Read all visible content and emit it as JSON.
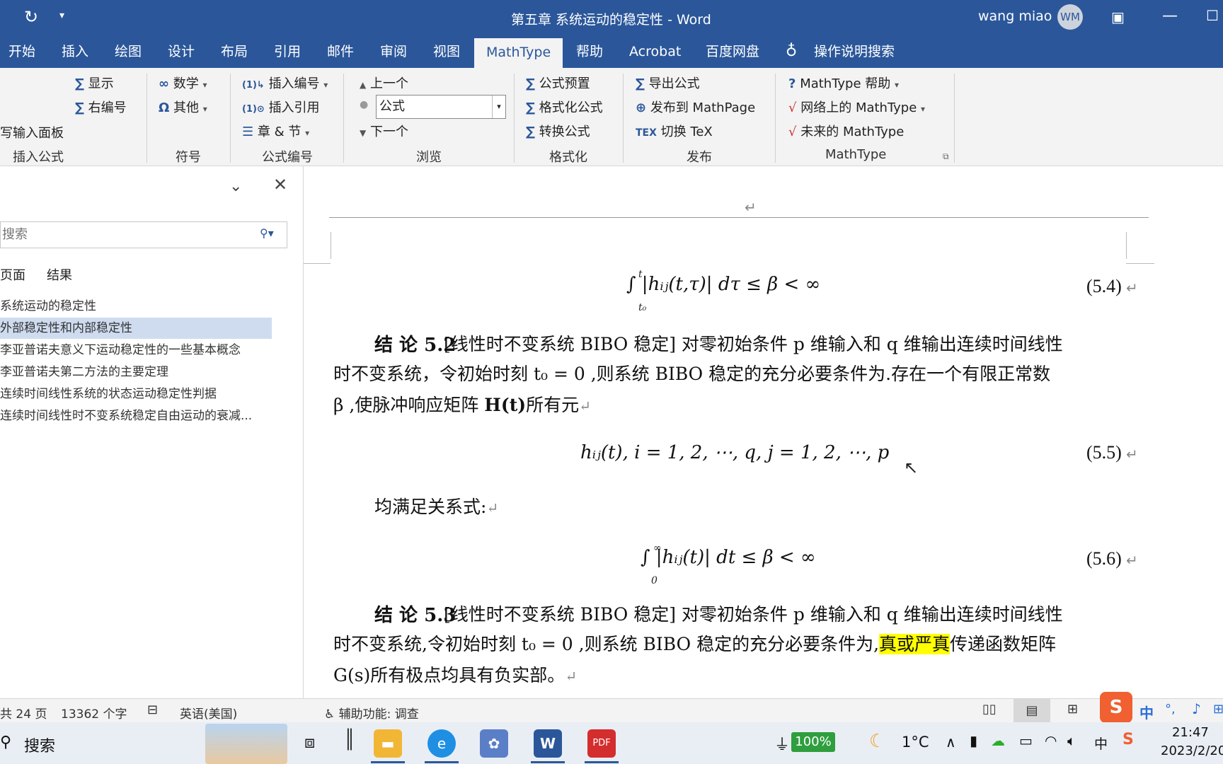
{
  "title_bar": {
    "title": "第五章 系统运动的稳定性  -  Word",
    "user_name": "wang miao",
    "avatar_initials": "WM"
  },
  "ribbon_tabs": [
    "开始",
    "插入",
    "绘图",
    "设计",
    "布局",
    "引用",
    "邮件",
    "审阅",
    "视图",
    "MathType",
    "帮助",
    "Acrobat",
    "百度网盘"
  ],
  "active_tab": "MathType",
  "tell_me": "操作说明搜索",
  "ribbon": {
    "insert_equation": {
      "group": "插入公式",
      "handwrite": "写输入面板",
      "display": "显示",
      "right_number": "右编号"
    },
    "symbols": {
      "group": "符号",
      "math": "数学",
      "other": "其他"
    },
    "equation_numbers": {
      "group": "公式编号",
      "insert_number": "插入编号",
      "insert_reference": "插入引用",
      "chapter_section": "章 & 节"
    },
    "browse": {
      "group": "浏览",
      "previous": "上一个",
      "field_value": "公式",
      "next": "下一个"
    },
    "format": {
      "group": "格式化",
      "presets": "公式预置",
      "format_equations": "格式化公式",
      "convert": "转换公式"
    },
    "publish": {
      "group": "发布",
      "export": "导出公式",
      "mathpage": "发布到 MathPage",
      "toggle_tex": "切换 TeX"
    },
    "mathtype": {
      "group": "MathType",
      "help": "MathType 帮助",
      "online": "网络上的 MathType",
      "future": "未来的 MathType"
    }
  },
  "nav_pane": {
    "search_placeholder": "搜索",
    "tab_pages": "页面",
    "tab_results": "结果",
    "headings": [
      "系统运动的稳定性",
      "外部稳定性和内部稳定性",
      "李亚普诺夫意义下运动稳定性的一些基本概念",
      "李亚普诺夫第二方法的主要定理",
      "连续时间线性系统的状态运动稳定性判据",
      "连续时间线性时不变系统稳定自由运动的衰减..."
    ],
    "selected_index": 1
  },
  "document": {
    "eq_5_4": "∫ |hᵢⱼ(t,τ)| dτ ≤ β < ∞",
    "eq_5_4_lower": "t₀",
    "eq_5_4_upper": "t",
    "eq_5_4_num": "(5.4)",
    "c52_label": "结 论 5.2",
    "c52_line1": "[线性时不变系统 BIBO 稳定] 对零初始条件 p 维输入和 q 维输出连续时间线性",
    "c52_line2": "时不变系统，令初始时刻 t₀ = 0 ,则系统 BIBO 稳定的充分必要条件为.存在一个有限正常数",
    "c52_line3a": "β ,使脉冲响应矩阵 ",
    "c52_line3b": "H(t)",
    "c52_line3c": "所有元",
    "eq_5_5": "hᵢⱼ(t),   i = 1, 2, ⋯, q, j = 1, 2, ⋯, p",
    "eq_5_5_num": "(5.5)",
    "satisfy": "均满足关系式:",
    "eq_5_6": "∫ |hᵢⱼ(t)|  dt ≤ β < ∞",
    "eq_5_6_lower": "0",
    "eq_5_6_upper": "∞",
    "eq_5_6_num": "(5.6)",
    "c53_label": "结 论 5.3",
    "c53_line1": "[线性时不变系统 BIBO 稳定] 对零初始条件 p 维输入和 q 维输出连续时间线性",
    "c53_line2a": "时不变系统,令初始时刻 t₀ = 0 ,则系统 BIBO 稳定的充分必要条件为,",
    "c53_highlight": "真或严真",
    "c53_line2b": "传递函数矩阵",
    "c53_line3": "G(s)所有极点均具有负实部。",
    "pilcrow": "↵"
  },
  "status_bar": {
    "page_count": "共 24 页",
    "word_count": "13362 个字",
    "language": "英语(美国)",
    "accessibility": "辅助功能: 调查"
  },
  "taskbar": {
    "search": "搜索",
    "battery": "100%",
    "temperature": "1°C",
    "time": "21:47",
    "date": "2023/2/20",
    "ime": "中"
  },
  "colors": {
    "word_blue": "#2b579a",
    "highlight": "#ffff00",
    "nav_selected": "#cfdcf0"
  }
}
